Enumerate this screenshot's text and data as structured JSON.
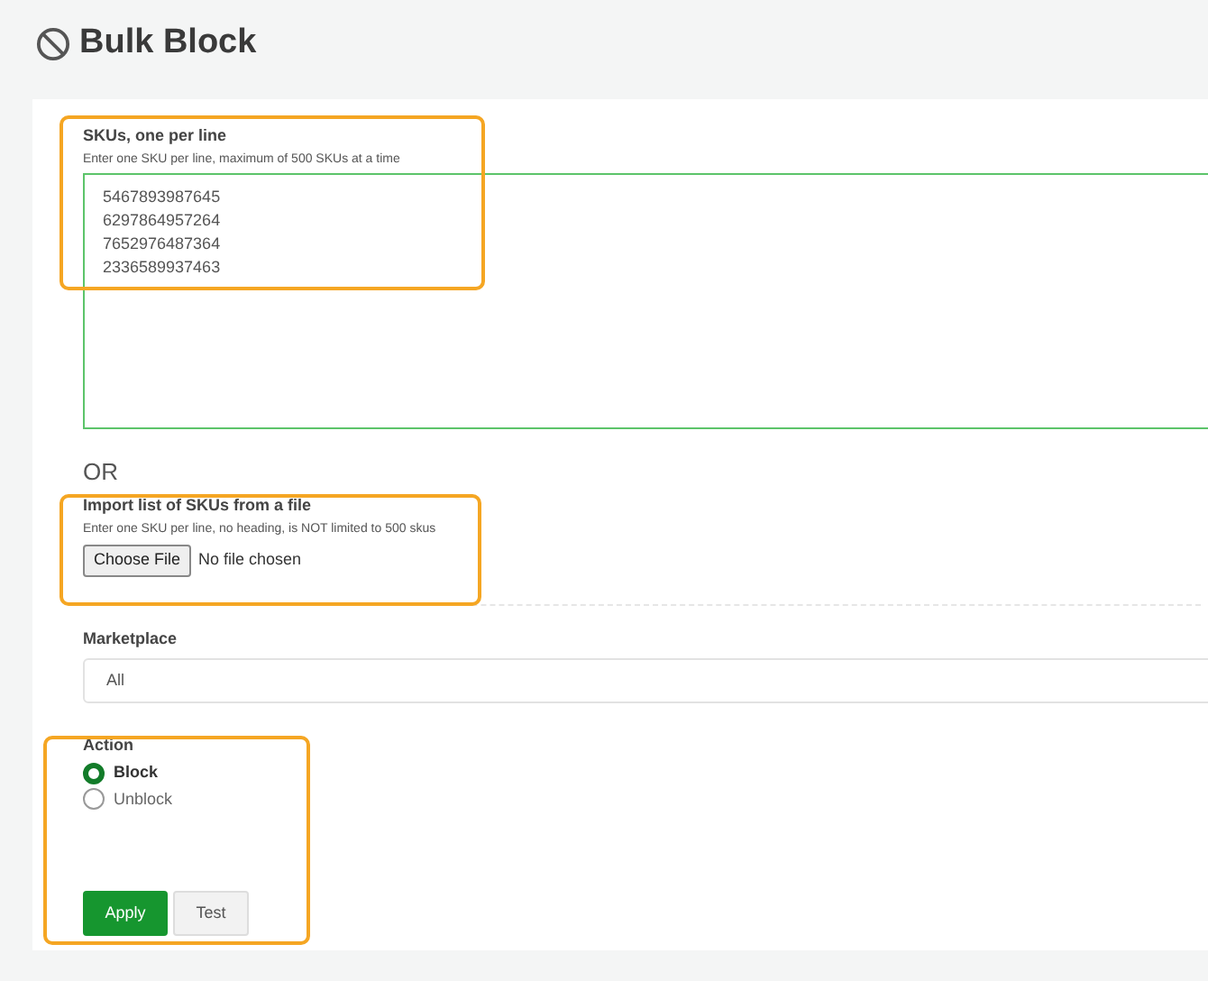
{
  "page": {
    "title": "Bulk Block"
  },
  "skus": {
    "label": "SKUs, one per line",
    "hint": "Enter one SKU per line, maximum of 500 SKUs at a time",
    "value": "5467893987645\n6297864957264\n7652976487364\n2336589937463"
  },
  "separator": "OR",
  "file_import": {
    "label": "Import list of SKUs from a file",
    "hint": "Enter one SKU per line, no heading, is NOT limited to 500 skus",
    "button": "Choose File",
    "status": "No file chosen"
  },
  "marketplace": {
    "label": "Marketplace",
    "value": "All"
  },
  "action": {
    "label": "Action",
    "options": [
      {
        "label": "Block",
        "selected": true
      },
      {
        "label": "Unblock",
        "selected": false
      }
    ]
  },
  "buttons": [
    {
      "label": "Apply",
      "kind": "primary"
    },
    {
      "label": "Test",
      "kind": "secondary"
    }
  ]
}
